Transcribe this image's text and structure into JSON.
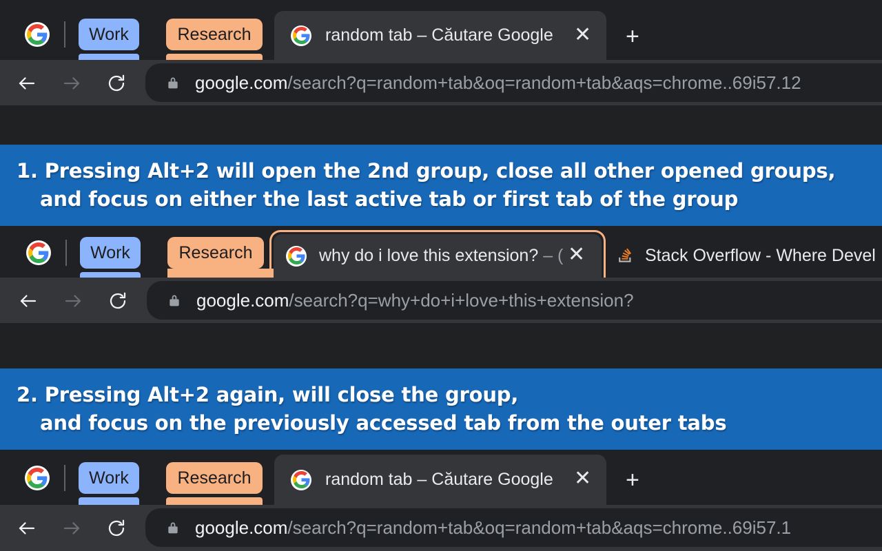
{
  "browser": {
    "logo_icon": "google-logo-icon",
    "groups": [
      {
        "label": "Work",
        "color": "#8cb4fc"
      },
      {
        "label": "Research",
        "color": "#f8b181"
      }
    ],
    "nav": {
      "back_icon": "back-arrow-icon",
      "forward_icon": "forward-arrow-icon",
      "reload_icon": "reload-icon",
      "lock_icon": "lock-icon"
    },
    "new_tab_icon": "plus-icon",
    "close_icon": "close-icon"
  },
  "sections": [
    {
      "id": "section-1",
      "tabs": [
        {
          "title": "random tab – Căutare Google",
          "dim_suffix": "",
          "favicon": "google-favicon-icon",
          "active": true,
          "grouped": false
        }
      ],
      "url": {
        "domain": "google.com",
        "path": "/search?q=random+tab&oq=random+tab&aqs=chrome..69i57.12"
      }
    },
    {
      "id": "section-2",
      "tabs": [
        {
          "title": "why do i love this extension? ",
          "dim_suffix": "– (",
          "favicon": "google-favicon-icon",
          "active": true,
          "grouped": true
        },
        {
          "title": "Stack Overflow - Where Devel",
          "dim_suffix": "",
          "favicon": "stackoverflow-favicon-icon",
          "active": false,
          "grouped": false
        }
      ],
      "url": {
        "domain": "google.com",
        "path": "/search?q=why+do+i+love+this+extension?"
      }
    },
    {
      "id": "section-3",
      "tabs": [
        {
          "title": "random tab – Căutare Google",
          "dim_suffix": "",
          "favicon": "google-favicon-icon",
          "active": true,
          "grouped": false
        }
      ],
      "url": {
        "domain": "google.com",
        "path": "/search?q=random+tab&oq=random+tab&aqs=chrome..69i57.1"
      }
    }
  ],
  "banners": [
    {
      "id": "banner-1",
      "line1": "1. Pressing Alt+2 will open the 2nd group, close all other opened groups,",
      "line2": "and focus on either the last active tab or first tab of the group",
      "color": "#1868b8"
    },
    {
      "id": "banner-2",
      "line1": "2. Pressing Alt+2 again, will close the group,",
      "line2": "and focus on the previously accessed tab from the outer tabs",
      "color": "#1868b8"
    }
  ]
}
